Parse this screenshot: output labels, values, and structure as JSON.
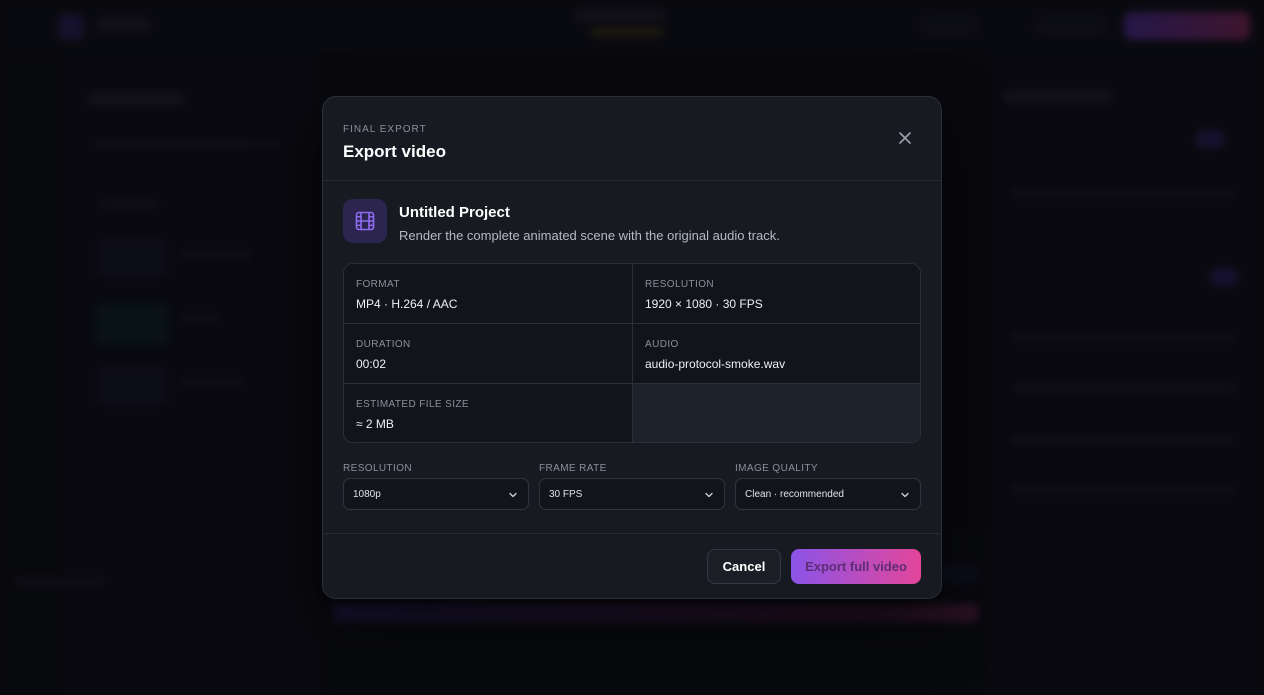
{
  "modal": {
    "eyebrow": "FINAL EXPORT",
    "title": "Export video",
    "close_icon": "close-icon"
  },
  "project": {
    "icon": "film-icon",
    "name": "Untitled Project",
    "description": "Render the complete animated scene with the original audio track."
  },
  "info": {
    "format": {
      "label": "FORMAT",
      "value": "MP4 · H.264 / AAC"
    },
    "resolution": {
      "label": "RESOLUTION",
      "value": "1920 × 1080 · 30 FPS"
    },
    "duration": {
      "label": "DURATION",
      "value": "00:02"
    },
    "audio": {
      "label": "AUDIO",
      "value": "audio-protocol-smoke.wav"
    },
    "file_size": {
      "label": "ESTIMATED FILE SIZE",
      "value": "≈ 2 MB"
    }
  },
  "settings": {
    "resolution": {
      "label": "RESOLUTION",
      "value": "1080p"
    },
    "frame_rate": {
      "label": "FRAME RATE",
      "value": "30 FPS"
    },
    "image_quality": {
      "label": "IMAGE QUALITY",
      "value": "Clean · recommended"
    }
  },
  "footer": {
    "cancel_label": "Cancel",
    "export_label": "Export full video"
  },
  "colors": {
    "accent_start": "#8b54e8",
    "accent_end": "#e3469a",
    "icon_tile": "#2c2550",
    "icon_glyph": "#8f6df2"
  }
}
